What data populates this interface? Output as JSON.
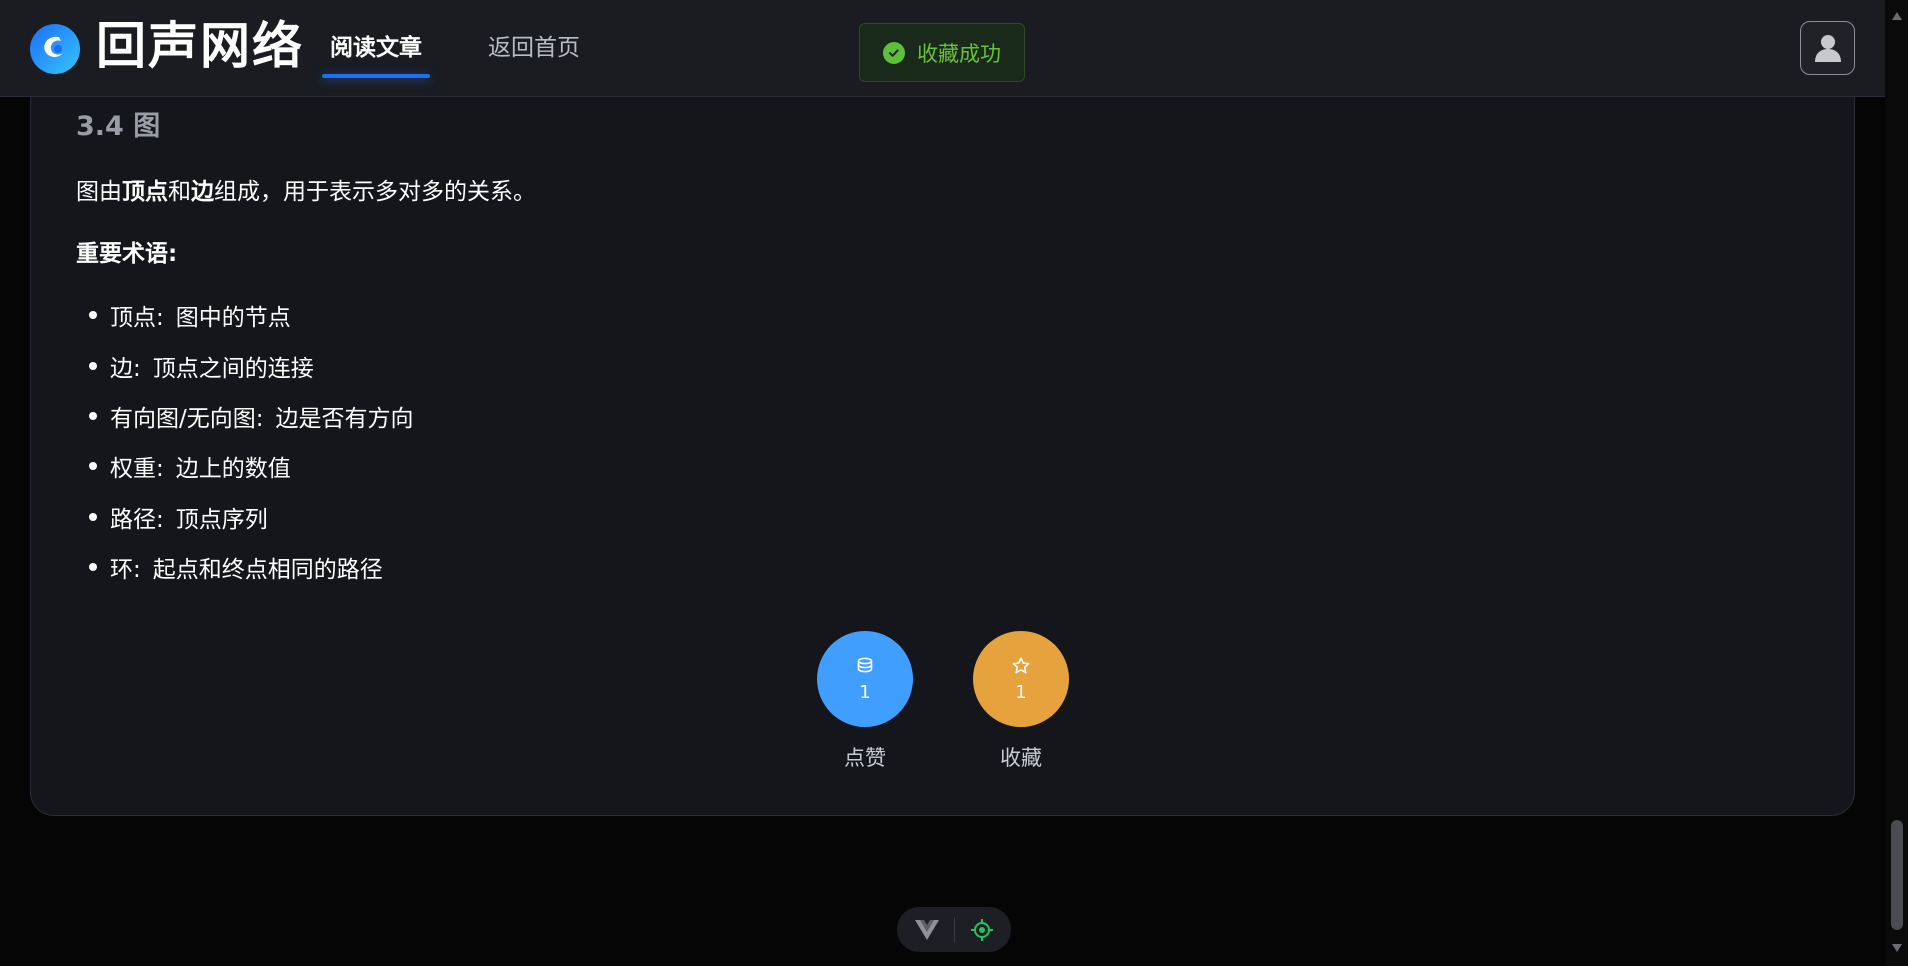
{
  "header": {
    "brand": "回声网络",
    "nav": [
      {
        "label": "阅读文章",
        "active": true
      },
      {
        "label": "返回首页",
        "active": false
      }
    ],
    "toast": "收藏成功"
  },
  "article": {
    "section_title": "3.4 图",
    "paragraph": {
      "prefix": "图由",
      "bold1": "顶点",
      "mid": "和",
      "bold2": "边",
      "suffix": "组成，用于表示多对多的关系。"
    },
    "terms_heading": "重要术语:",
    "terms": [
      {
        "term": "顶点:",
        "def": "图中的节点"
      },
      {
        "term": "边:",
        "def": "顶点之间的连接"
      },
      {
        "term": "有向图/无向图:",
        "def": "边是否有方向"
      },
      {
        "term": "权重:",
        "def": "边上的数值"
      },
      {
        "term": "路径:",
        "def": "顶点序列"
      },
      {
        "term": "环:",
        "def": "起点和终点相同的路径"
      }
    ]
  },
  "actions": {
    "like": {
      "count": "1",
      "label": "点赞",
      "color": "#409eff"
    },
    "favorite": {
      "count": "1",
      "label": "收藏",
      "color": "#e6a23c"
    }
  },
  "colors": {
    "accent": "#1f6ff2",
    "success": "#67c23a"
  }
}
